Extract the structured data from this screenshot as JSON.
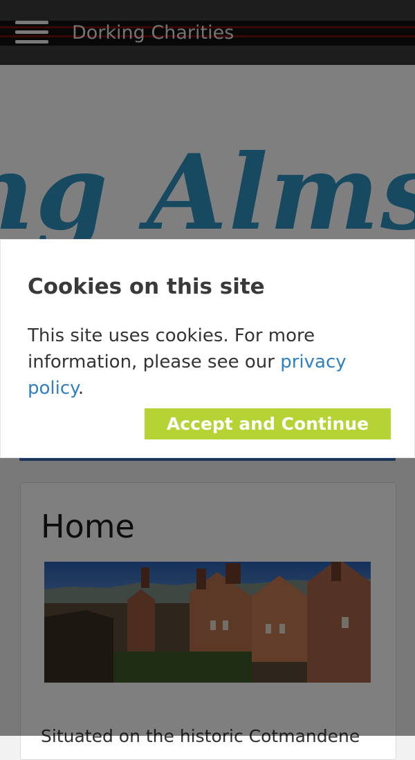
{
  "header": {
    "title": "Dorking Charities",
    "menu_icon": "hamburger-icon"
  },
  "banner": {
    "text": "ng Almsh"
  },
  "main": {
    "heading": "Home",
    "intro": "Situated on the historic Cotmandene"
  },
  "cookie_notice": {
    "title": "Cookies on this site",
    "text": "This site uses cookies. For more information, please see our",
    "link_text": "privacy policy",
    "after_link": ".",
    "button_label": "Accept and Continue"
  },
  "colors": {
    "accent_green": "#b5d334",
    "link_blue": "#2f80c2",
    "banner_blue": "#2f93c2"
  }
}
